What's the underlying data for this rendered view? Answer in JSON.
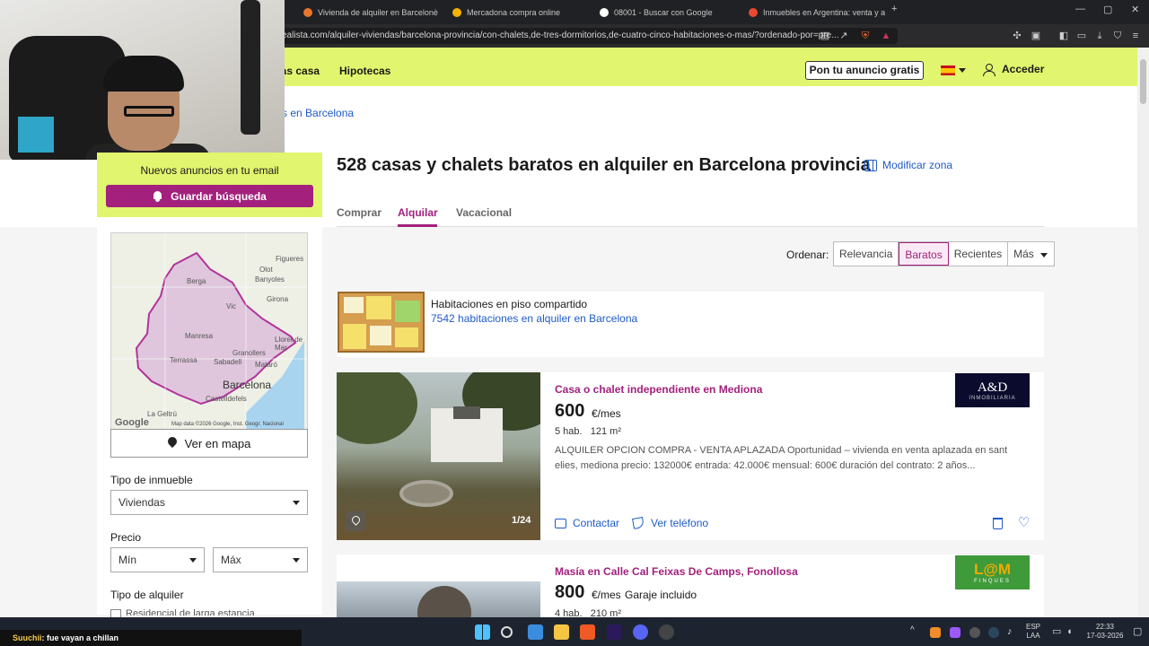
{
  "browser": {
    "tabs": [
      {
        "title": "Vivienda de alquiler en Barcelonès - I",
        "color": "#e8772e"
      },
      {
        "title": "Mercadona compra online",
        "color": "#f0b400"
      },
      {
        "title": "08001 - Buscar con Google",
        "color": "#ffffff"
      },
      {
        "title": "Inmuebles en Argentina: venta y alq",
        "color": "#e84a2e"
      }
    ],
    "url": "ealista.com/alquiler-viviendas/barcelona-provincia/con-chalets,de-tres-dormitorios,de-cuatro-cinco-habitaciones-o-mas/?ordenado-por=pre..."
  },
  "header": {
    "nav": [
      "cas casa",
      "Hipotecas"
    ],
    "publish_label": "Pon tu anuncio gratis",
    "login_label": "Acceder"
  },
  "breadcrumb": "s en Barcelona",
  "alert": {
    "text": "Nuevos anuncios en tu email",
    "button": "Guardar búsqueda"
  },
  "map": {
    "places": [
      "Figueres",
      "Olot",
      "Berga",
      "Banyoles",
      "Girona",
      "Vic",
      "Manresa",
      "Lloret de Mar",
      "Terrassa",
      "Granollers",
      "Sabadell",
      "Mataró",
      "Castelldefels",
      "La Geltrú"
    ],
    "city": "Barcelona",
    "google": "Google",
    "credit": "Map data ©2026 Google, Inst. Geogr. Nacional",
    "button": "Ver en mapa"
  },
  "filters": {
    "type_label": "Tipo de inmueble",
    "type_value": "Viviendas",
    "price_label": "Precio",
    "min": "Mín",
    "max": "Máx",
    "rental_label": "Tipo de alquiler",
    "rental_option": "Residencial de larga estancia"
  },
  "main": {
    "title": "528 casas y chalets baratos en alquiler en Barcelona provincia",
    "modify_zone": "Modificar zona",
    "operations": [
      "Comprar",
      "Alquilar",
      "Vacacional"
    ],
    "sort_label": "Ordenar:",
    "sort_options": [
      "Relevancia",
      "Baratos",
      "Recientes",
      "Más"
    ]
  },
  "promo": {
    "title": "Habitaciones en piso compartido",
    "link": "7542 habitaciones en alquiler en Barcelona"
  },
  "listings": [
    {
      "title": "Casa o chalet independiente en Mediona",
      "price": "600",
      "unit": "€/mes",
      "extra": "",
      "details": "5 hab.   121 m²",
      "description": "ALQUILER OPCION COMPRA - VENTA APLAZADA Oportunidad – vivienda en venta aplazada en sant elies, mediona precio: 132000€ entrada: 42.000€ mensual: 600€ duración del contrato: 2 años...",
      "photo_counter": "1/24",
      "contact": "Contactar",
      "phone": "Ver teléfono",
      "logo_name": "A&D",
      "logo_sub": "INMOBILIARIA",
      "logo_color": "#0b0b2e"
    },
    {
      "title": "Masía en Calle Cal Feixas De Camps, Fonollosa",
      "price": "800",
      "unit": "€/mes",
      "extra": "Garaje incluido",
      "details": "4 hab.   210 m²",
      "logo_name": "L@M",
      "logo_sub": "FINQUES",
      "logo_color": "#3f9a3a"
    }
  ],
  "stream": {
    "user": "Suuchii",
    "message": ": fue vayan a chillan"
  },
  "taskbar": {
    "lang": "ESP",
    "region": "LAA",
    "time": "22:33",
    "date": "17-03-2026"
  }
}
